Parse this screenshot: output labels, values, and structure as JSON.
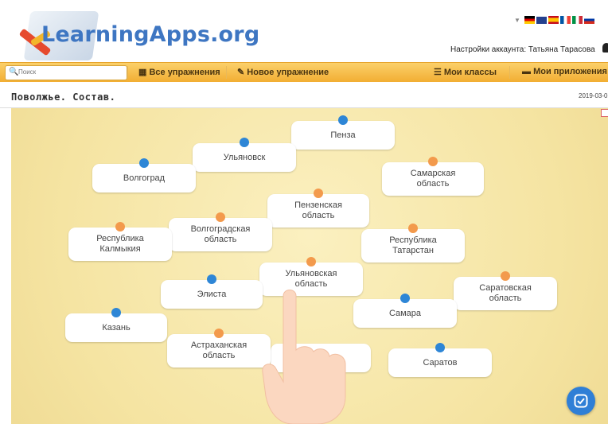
{
  "header": {
    "logo_text": "LearningApps.org",
    "account_text": "Настройки аккаунта: Татьяна Тарасова",
    "flags": [
      "german-flag",
      "uk-flag",
      "spanish-flag",
      "french-flag",
      "italian-flag",
      "russian-flag"
    ]
  },
  "navbar": {
    "search_placeholder": "Поиск",
    "all_exercises": "Все упражнения",
    "new_exercise": "Новое упражнение",
    "my_classes": "Мои классы",
    "my_apps": "Мои приложения"
  },
  "page": {
    "title": "Поволжье. Состав.",
    "date": "2019-03-0"
  },
  "cards": [
    {
      "label": "Пенза",
      "dot": "blue"
    },
    {
      "label": "Ульяновск",
      "dot": "blue"
    },
    {
      "label": "Волгоград",
      "dot": "blue"
    },
    {
      "label": "Самарская область",
      "dot": "orange"
    },
    {
      "label": "Пензенская область",
      "dot": "orange"
    },
    {
      "label": "Волгоградская область",
      "dot": "orange"
    },
    {
      "label": "Республика Калмыкия",
      "dot": "orange"
    },
    {
      "label": "Республика Татарстан",
      "dot": "orange"
    },
    {
      "label": "Ульяновская область",
      "dot": "orange"
    },
    {
      "label": "Элиста",
      "dot": "blue"
    },
    {
      "label": "Саратовская область",
      "dot": "orange"
    },
    {
      "label": "Самара",
      "dot": "blue"
    },
    {
      "label": "Казань",
      "dot": "blue"
    },
    {
      "label": "Астраханская область",
      "dot": "orange"
    },
    {
      "label": "Саратов",
      "dot": "blue"
    }
  ],
  "colors": {
    "nav_bar": "#f2ae33",
    "board": "#f5e4a2",
    "blue_dot": "#2e86d6",
    "orange_dot": "#f39a4c",
    "logo": "#3e76c2"
  }
}
